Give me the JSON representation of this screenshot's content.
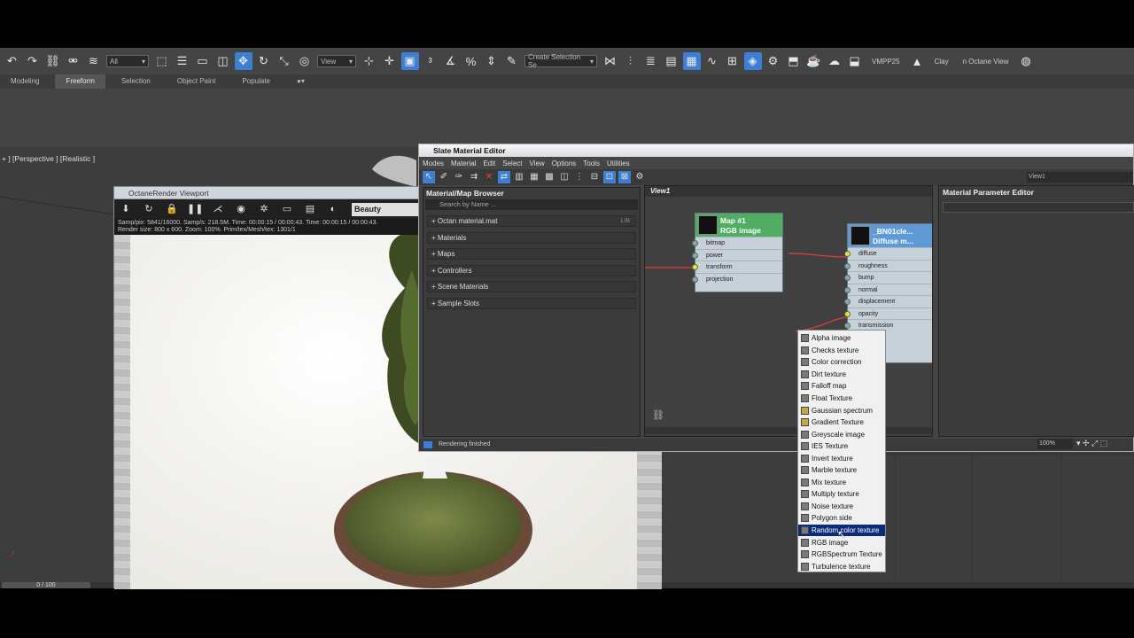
{
  "toolbar": {
    "select_filter": "All",
    "view_ref": "View",
    "selection_set_placeholder": "Create Selection Se",
    "labels": [
      "VMPP25",
      "Clay",
      "n Octane View"
    ]
  },
  "ribbon": {
    "tabs": [
      "Modeling",
      "Freeform",
      "Selection",
      "Object Paint",
      "Populate"
    ],
    "active_tab": "Freeform"
  },
  "viewport": {
    "label": "+ ] [Perspective ] [Realistic ]"
  },
  "timeslider": {
    "value": "0 / 100"
  },
  "octane": {
    "title": "OctaneRender Viewport",
    "render_pass": "Beauty",
    "stats_line1": "Samp/pix: 5841/16000.   Samp/s: 218.5M.   Time: 00:00:15 / 00:00:43.   Time: 00:00:15 / 00:00:43.",
    "stats_line2": "Render size: 800 x 600.   Zoom: 100%.   Prim/tex/Mesh/tex: 1301/1"
  },
  "slate": {
    "title": "Slate Material Editor",
    "menu": [
      "Modes",
      "Material",
      "Edit",
      "Select",
      "View",
      "Options",
      "Tools",
      "Utilities"
    ],
    "view_dropdown": "View1",
    "browser": {
      "title": "Material/Map Browser",
      "search_placeholder": "Search by Name ...",
      "lib_badge": "LIB",
      "groups": [
        "+ Octan material.mat",
        "+ Materials",
        "+ Maps",
        "+ Controllers",
        "+ Scene Materials",
        "+ Sample Slots"
      ]
    },
    "view_tab": "View1",
    "node_map": {
      "title1": "Map #1",
      "title2": "RGB image",
      "slots": [
        "bitmap",
        "power",
        "transform",
        "projection"
      ]
    },
    "node_mat": {
      "title1": "_BN01cle...",
      "title2": "Diffuse m...",
      "slots": [
        "diffuse",
        "roughness",
        "bump",
        "normal",
        "displacement",
        "opacity",
        "transmission"
      ]
    },
    "param_editor_title": "Material Parameter Editor",
    "status": "Rendering finished",
    "zoom": "100%"
  },
  "context_menu": {
    "items": [
      "Alpha image",
      "Checks texture",
      "Color correction",
      "Dirt texture",
      "Falloff map",
      "Float Texture",
      "Gaussian spectrum",
      "Gradient Texture",
      "Greyscale image",
      "IES Texture",
      "Invert texture",
      "Marble texture",
      "Mix texture",
      "Multiply texture",
      "Noise texture",
      "Polygon side",
      "Random color texture",
      "RGB image",
      "RGBSpectrum Texture",
      "Turbulence texture"
    ],
    "highlighted": "Random color texture"
  },
  "colors": {
    "accent": "#3c7fd4",
    "highlight": "#0b2b7a",
    "node_header_map": "#4fae62",
    "node_header_mat": "#5f9ad6",
    "wire": "#e23c3c"
  }
}
